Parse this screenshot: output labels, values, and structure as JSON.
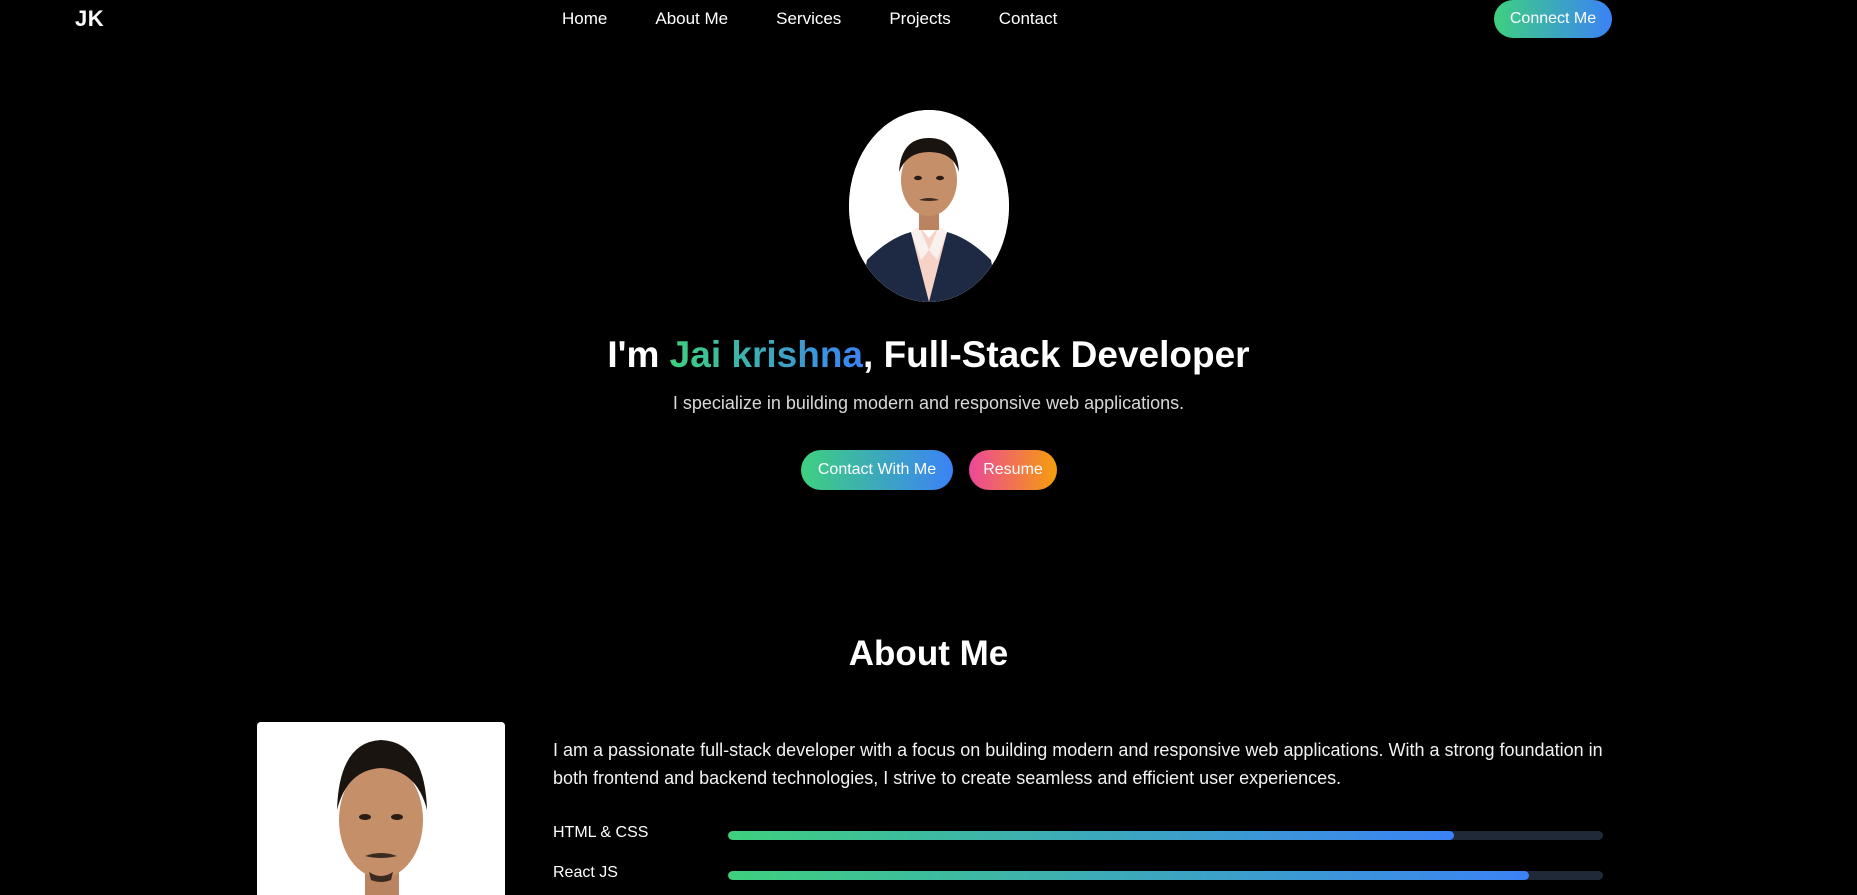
{
  "nav": {
    "logo": "JK",
    "links": [
      "Home",
      "About Me",
      "Services",
      "Projects",
      "Contact"
    ],
    "cta": "Connect Me"
  },
  "hero": {
    "title_prefix": "I'm ",
    "name": "Jai krishna",
    "title_suffix": ", Full-Stack Developer",
    "subtitle": "I specialize in building modern and responsive web applications.",
    "buttons": {
      "contact": "Contact With Me",
      "resume": "Resume"
    }
  },
  "about": {
    "heading": "About Me",
    "bio": "I am a passionate full-stack developer with a focus on building modern and responsive web applications. With a strong foundation in both frontend and backend technologies, I strive to create seamless and efficient user experiences.",
    "skills": [
      {
        "label": "HTML & CSS",
        "level": 0.83
      },
      {
        "label": "React JS",
        "level": 0.915
      }
    ]
  },
  "colors": {
    "background": "#000000",
    "accent_green": "#3ed07f",
    "accent_blue": "#3b82f6",
    "accent_pink": "#ec4899",
    "accent_orange": "#f59e0b",
    "track": "#1f2937"
  }
}
